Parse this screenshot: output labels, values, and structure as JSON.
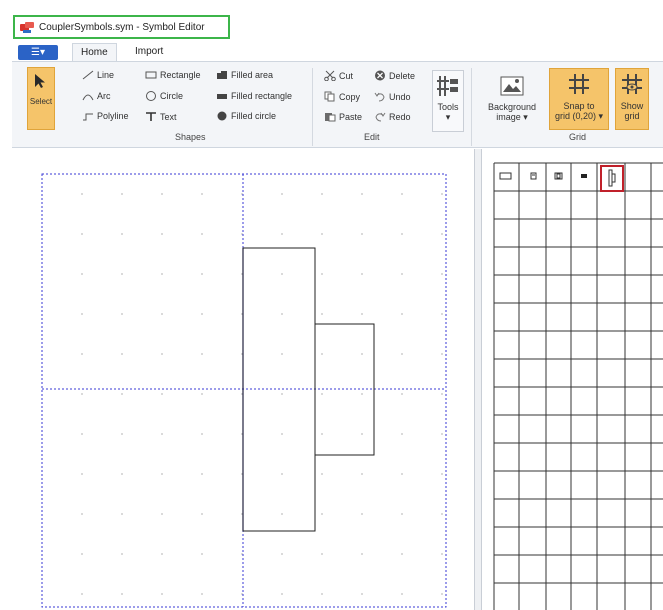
{
  "window": {
    "title": "CouplerSymbols.sym - Symbol Editor"
  },
  "tabs": [
    {
      "label": "Home"
    },
    {
      "label": "Import"
    }
  ],
  "ribbon": {
    "select_label": "Select",
    "shapes": {
      "line": "Line",
      "arc": "Arc",
      "polyline": "Polyline",
      "rectangle": "Rectangle",
      "circle": "Circle",
      "text": "Text",
      "filled_area": "Filled area",
      "filled_rectangle": "Filled rectangle",
      "filled_circle": "Filled circle",
      "group_label": "Shapes"
    },
    "edit": {
      "cut": "Cut",
      "copy": "Copy",
      "paste": "Paste",
      "delete": "Delete",
      "undo": "Undo",
      "redo": "Redo",
      "group_label": "Edit"
    },
    "tools_label": "Tools",
    "tools_arrow": "▾",
    "background_line1": "Background",
    "background_line2": "image ▾",
    "snap_line1": "Snap to",
    "snap_line2": "grid (0,20) ▾",
    "show_line1": "Show",
    "show_line2": "grid",
    "grid_group_label": "Grid"
  },
  "colors": {
    "accent_blue": "#2b63c6",
    "selected_orange": "#f5c46a",
    "title_highlight": "#3cb54a",
    "palette_selection": "#c0202a",
    "grid_blue": "#3a3ad6"
  }
}
